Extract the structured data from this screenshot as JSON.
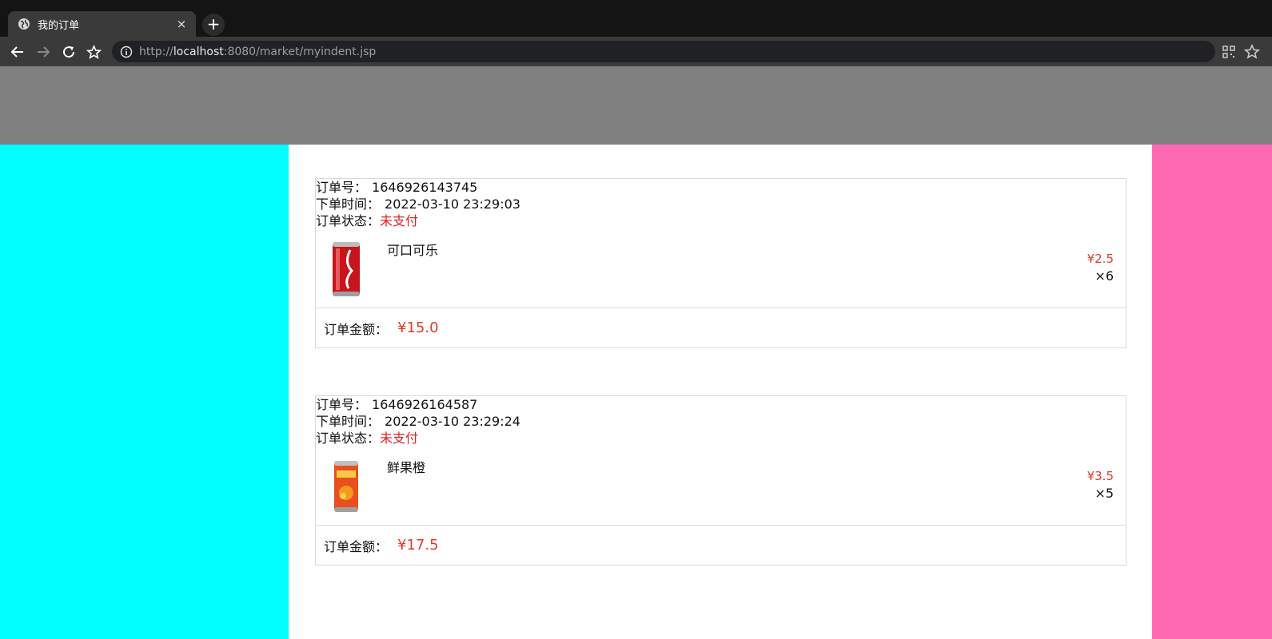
{
  "browser": {
    "tab_title": "我的订单",
    "new_tab": "+",
    "close": "×",
    "url_scheme": "http://",
    "url_host": "localhost",
    "url_rest": ":8080/market/myindent.jsp"
  },
  "labels": {
    "order_no": "订单号：",
    "order_time": "下单时间：",
    "order_status": "订单状态：",
    "order_amount": "订单金额："
  },
  "orders": [
    {
      "order_no": "1646926143745",
      "time": "2022-03-10 23:29:03",
      "status": "未支付",
      "item": {
        "name": "可口可乐",
        "price": "¥2.5",
        "qty": "×6",
        "icon": "coke-can"
      },
      "total": "¥15.0"
    },
    {
      "order_no": "1646926164587",
      "time": "2022-03-10 23:29:24",
      "status": "未支付",
      "item": {
        "name": "鲜果橙",
        "price": "¥3.5",
        "qty": "×5",
        "icon": "orange-juice-can"
      },
      "total": "¥17.5"
    }
  ],
  "colors": {
    "header": "#808080",
    "left": "#00ffff",
    "right": "#ff69b4",
    "accent": "#e03a2a"
  }
}
